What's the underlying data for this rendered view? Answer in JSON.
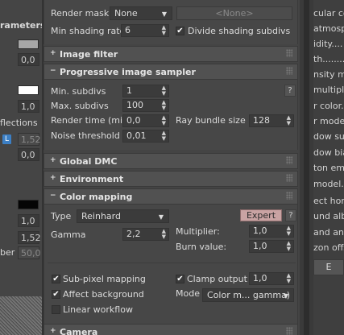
{
  "left_panel": {
    "header": "rameters",
    "fields": [
      "0,0",
      "1,0",
      "0,0",
      "1,0",
      "1,52",
      "50,0",
      "0,0"
    ],
    "labels": [
      "flections",
      "ber"
    ],
    "badge": "L",
    "colors": {
      "swatch_gray": "#a7a7a7",
      "swatch_white": "#ffffff",
      "swatch_black": "#050505"
    }
  },
  "top_section": {
    "render_mask_label": "Render mask",
    "render_mask_value": "None",
    "render_mask_none_button": "<None>",
    "min_shading_rate_label": "Min shading rate",
    "min_shading_rate_value": "6",
    "divide_shading_label": "Divide shading subdivs"
  },
  "rollouts": {
    "image_filter": "Image filter",
    "progressive_sampler": "Progressive image sampler",
    "global_dmc": "Global DMC",
    "environment": "Environment",
    "color_mapping": "Color mapping",
    "camera": "Camera"
  },
  "progressive": {
    "min_subdivs_label": "Min. subdivs",
    "min_subdivs_value": "1",
    "max_subdivs_label": "Max. subdivs",
    "max_subdivs_value": "100",
    "render_time_label": "Render time (min)",
    "render_time_value": "0,0",
    "ray_bundle_label": "Ray bundle size",
    "ray_bundle_value": "128",
    "noise_threshold_label": "Noise threshold",
    "noise_threshold_value": "0,01",
    "help": "?"
  },
  "color_mapping": {
    "type_label": "Type",
    "type_value": "Reinhard",
    "expert_button": "Expert",
    "help": "?",
    "gamma_label": "Gamma",
    "gamma_value": "2,2",
    "multiplier_label": "Multiplier:",
    "multiplier_value": "1,0",
    "burn_label": "Burn value:",
    "burn_value": "1,0",
    "subpixel_label": "Sub-pixel mapping",
    "clamp_label": "Clamp output",
    "clamp_value": "1,0",
    "affect_bg_label": "Affect background",
    "mode_label": "Mode",
    "mode_value": "Color m... gamma)",
    "linear_label": "Linear workflow"
  },
  "right_panel": {
    "lines": [
      "cular co",
      "atmosp",
      "idity....",
      "th........",
      "nsity mul",
      "multiplie",
      "r color..",
      "r mode..",
      "dow sub",
      "dow bias",
      "ton emit",
      "model...",
      "ect hori",
      "und albe",
      "and angle",
      "zon offs"
    ],
    "button": "E"
  }
}
